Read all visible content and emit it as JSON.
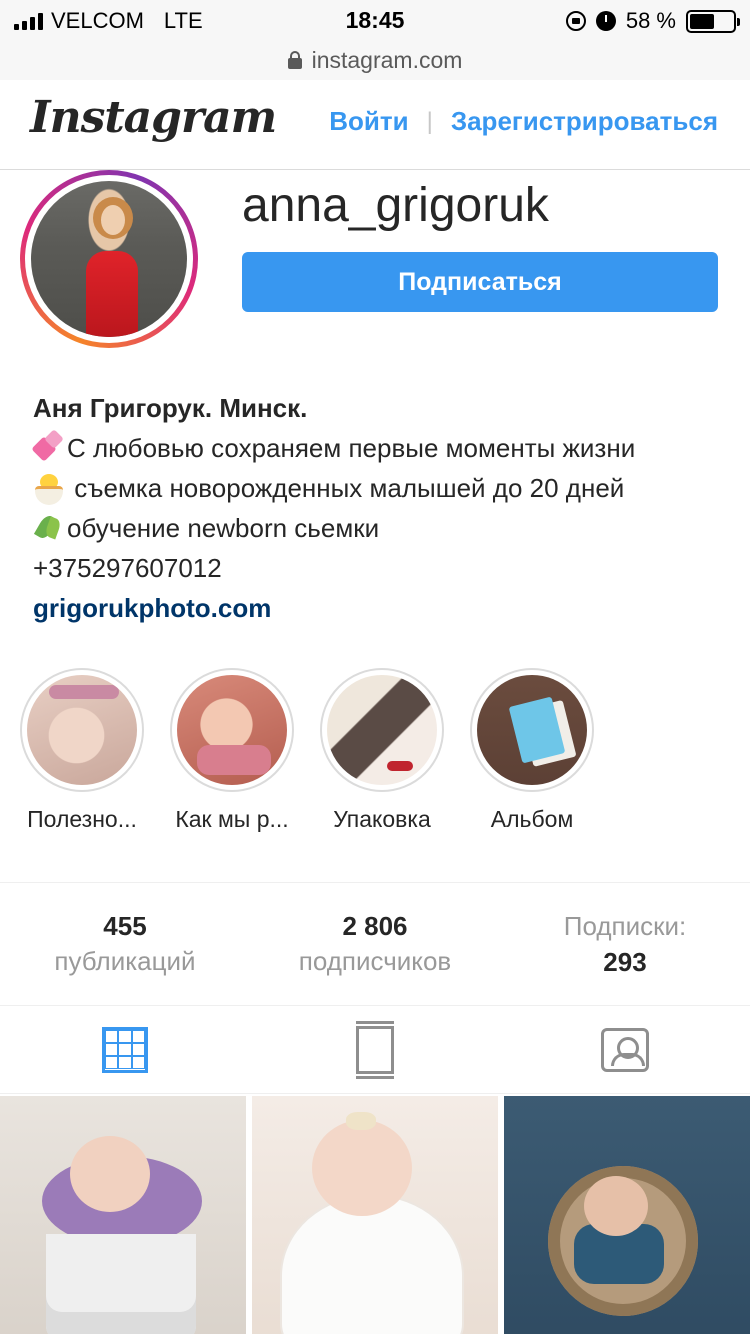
{
  "status_bar": {
    "carrier": "VELCOM",
    "network": "LTE",
    "time": "18:45",
    "battery": "58 %",
    "battery_fraction": 0.58
  },
  "browser": {
    "url": "instagram.com"
  },
  "header": {
    "logo": "Instagram",
    "login": "Войти",
    "separator": "|",
    "register": "Зарегистрироваться"
  },
  "profile": {
    "username": "anna_grigoruk",
    "follow_label": "Подписаться",
    "bio": {
      "name": "Аня Григорук. Минск.",
      "line1": "С любовью сохраняем первые моменты жизни",
      "line2": "съемка новорожденных малышей до 20 дней",
      "line3": "обучение newborn сьемки",
      "phone": "+375297607012",
      "link": "grigorukphoto.com"
    }
  },
  "highlights": [
    {
      "label": "Полезно..."
    },
    {
      "label": "Как мы р..."
    },
    {
      "label": "Упаковка"
    },
    {
      "label": "Альбом"
    }
  ],
  "stats": {
    "posts_value": "455",
    "posts_label": "публикаций",
    "followers_value": "2 806",
    "followers_label": "подписчиков",
    "following_label": "Подписки:",
    "following_value": "293"
  },
  "colors": {
    "accent": "#3897f0",
    "link": "#003569",
    "muted": "#999999"
  },
  "icons": {
    "grid_tab": "grid-icon",
    "feed_tab": "feed-icon",
    "tagged_tab": "tagged-icon"
  }
}
